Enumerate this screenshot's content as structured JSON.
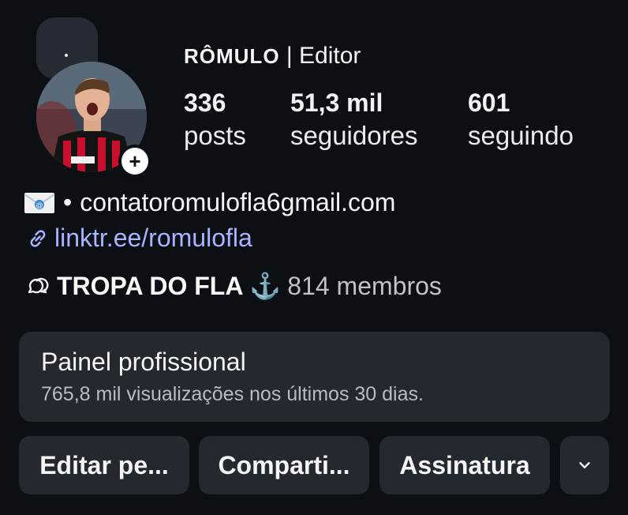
{
  "profile": {
    "name": "RÔMULO",
    "separator": " | ",
    "role": "Editor"
  },
  "stats": [
    {
      "value": "336",
      "label": "posts"
    },
    {
      "value": "51,3 mil",
      "label": "seguidores"
    },
    {
      "value": "601",
      "label": "seguindo"
    }
  ],
  "bio": {
    "email_prefix": "•",
    "email": "contatoromulofla6gmail.com",
    "link": "linktr.ee/romulofla"
  },
  "group": {
    "name": "TROPA DO FLA",
    "members": "814 membros"
  },
  "panel": {
    "title": "Painel profissional",
    "subtitle": "765,8 mil visualizações nos últimos 30 dias."
  },
  "buttons": {
    "edit": "Editar pe...",
    "share": "Comparti...",
    "subscription": "Assinatura"
  },
  "colors": {
    "background": "#0c0f14",
    "card": "#24282f",
    "link": "#a8b4ff"
  }
}
